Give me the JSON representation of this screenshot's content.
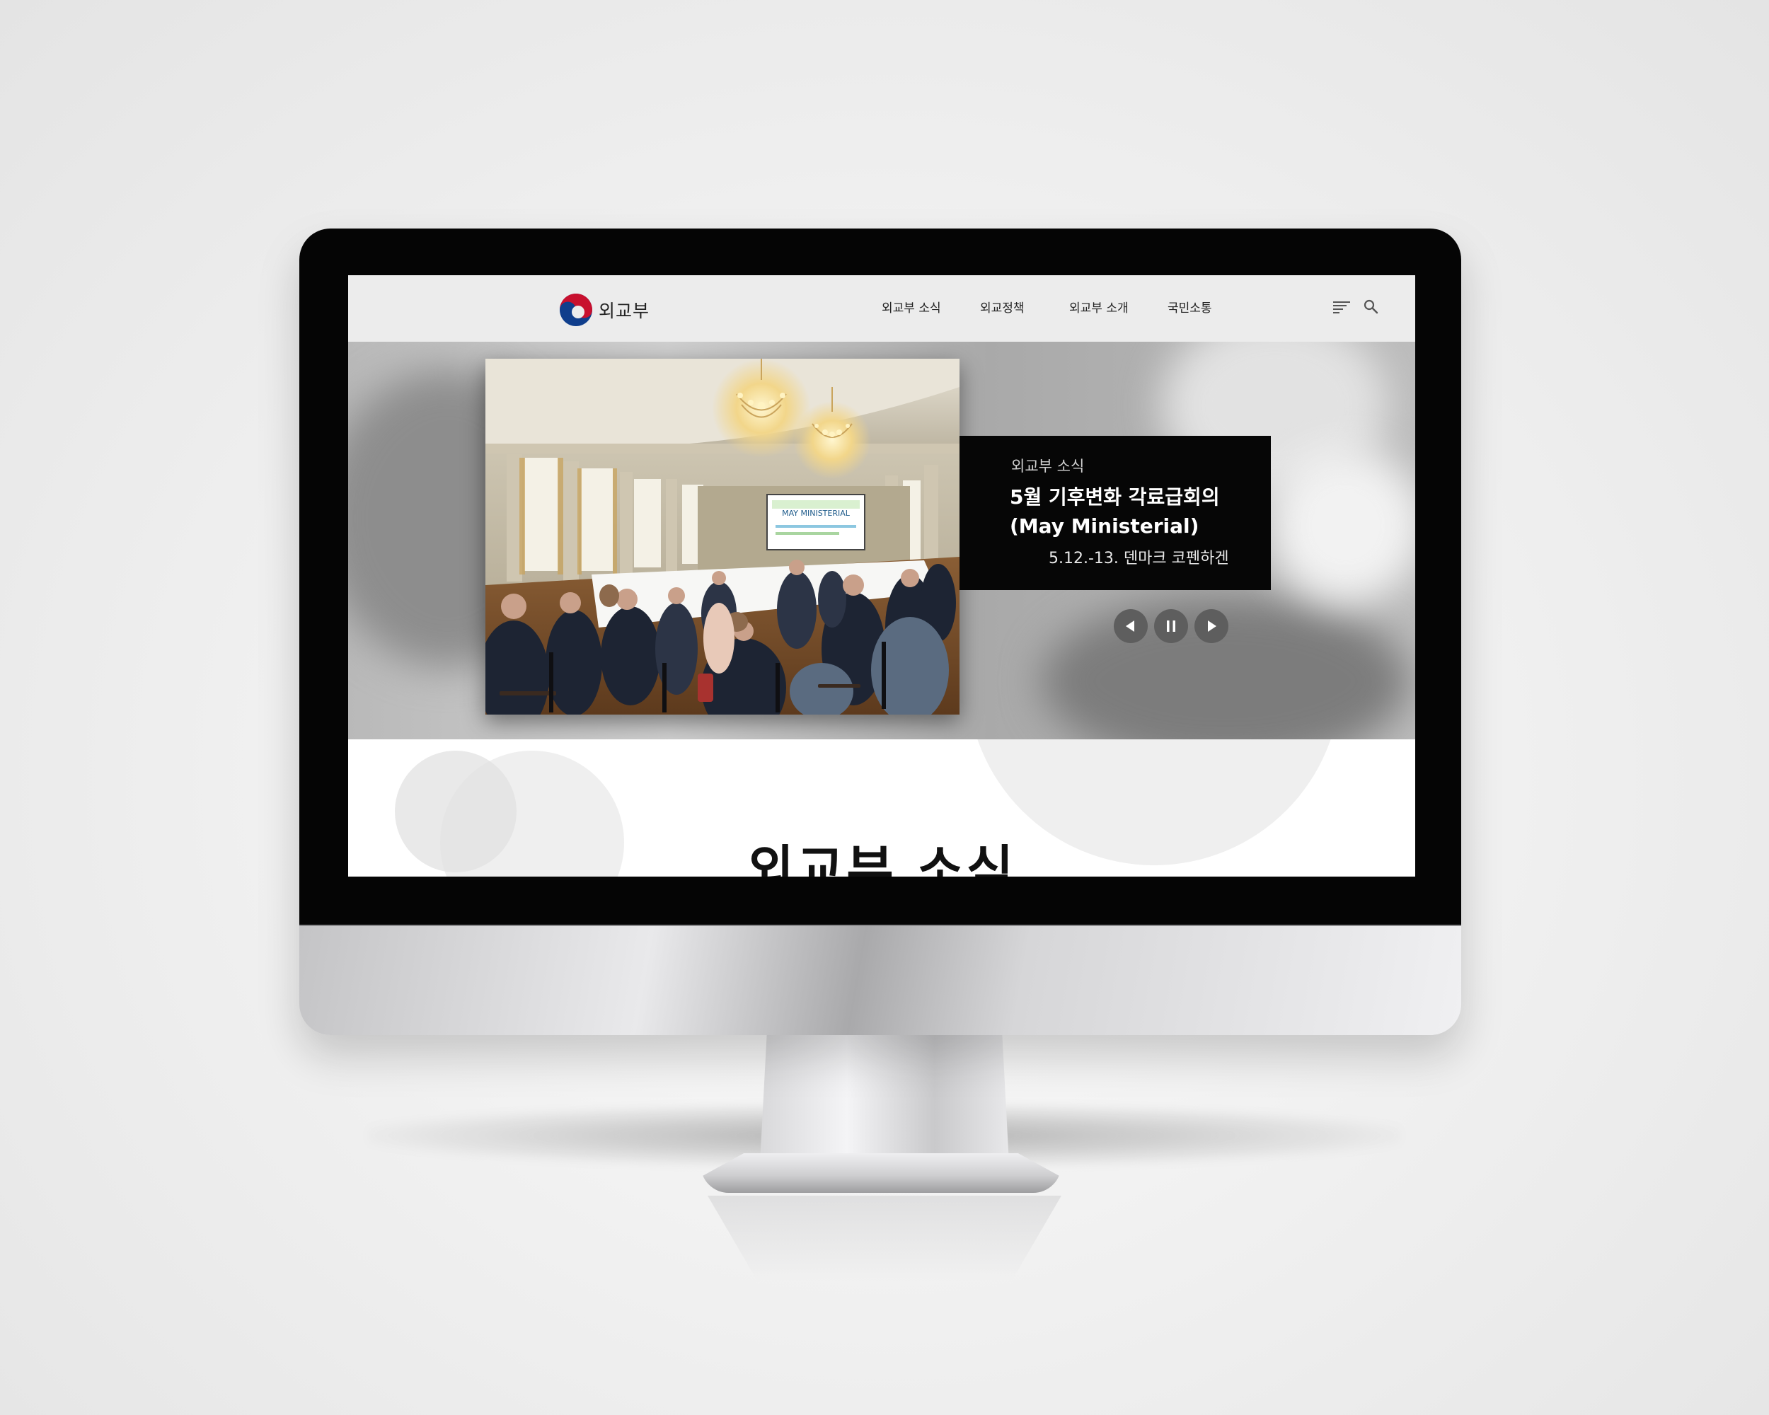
{
  "site": {
    "logo_text": "외교부"
  },
  "nav": {
    "items": [
      {
        "label": "외교부 소식"
      },
      {
        "label": "외교정책"
      },
      {
        "label": "외교부 소개"
      },
      {
        "label": "국민소통"
      }
    ]
  },
  "icons": {
    "menu": "menu-icon",
    "search": "search-icon",
    "prev": "prev-icon",
    "pause": "pause-icon",
    "next": "next-icon"
  },
  "hero": {
    "category": "외교부 소식",
    "title_line1": "5월 기후변화 각료급회의",
    "title_line2": "(May Ministerial)",
    "date_location": "5.12.-13. 덴마크 코펜하겐",
    "slide_text": "MAY MINISTERIAL"
  },
  "section": {
    "title": "외교부 소식"
  },
  "colors": {
    "topbar_bg": "#ececec",
    "caption_bg": "#060606",
    "control_bg": "#5e5e5e",
    "logo_red": "#c8102e",
    "logo_blue": "#0f3e8c"
  }
}
